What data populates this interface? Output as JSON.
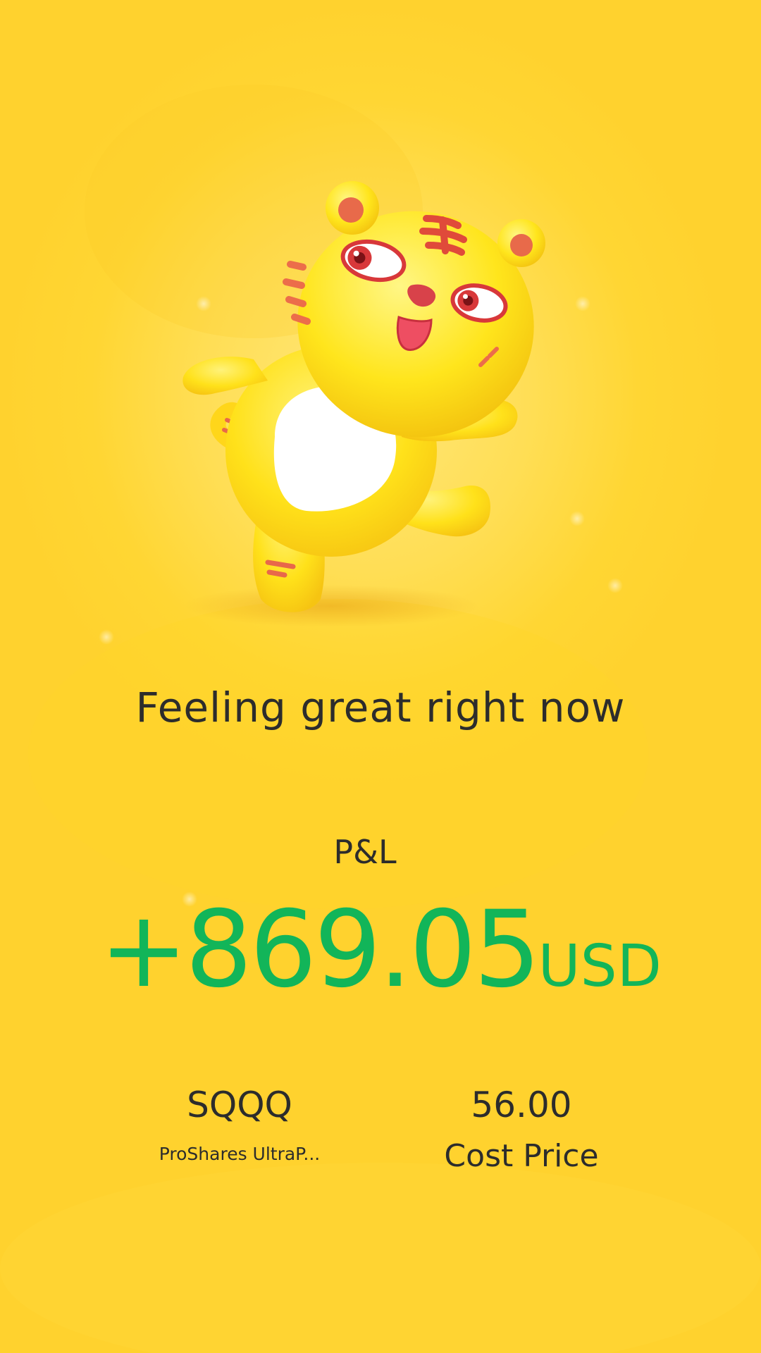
{
  "mood": {
    "message": "Feeling great right now"
  },
  "pnl": {
    "label": "P&L",
    "value": "+869.05",
    "currency": "USD",
    "color": "#12b559"
  },
  "position": {
    "symbol": "SQQQ",
    "name": "ProShares UltraP...",
    "cost_price": "56.00",
    "cost_price_label": "Cost Price"
  },
  "mascot": {
    "icon": "tiger-mascot-icon"
  },
  "theme": {
    "background": "#ffd633",
    "text": "#2c2c2c"
  }
}
